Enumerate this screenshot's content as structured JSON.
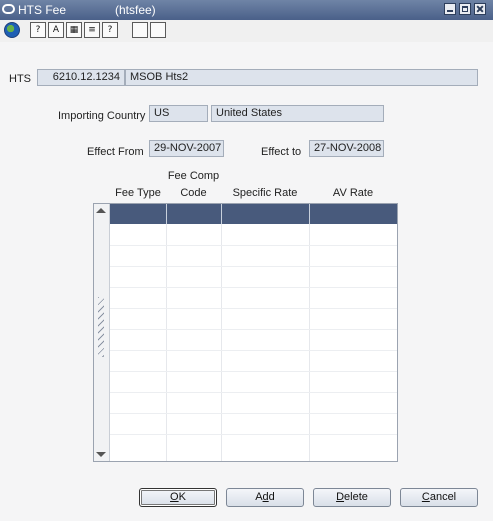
{
  "window": {
    "title": "HTS Fee",
    "subtitle": "(htsfee)"
  },
  "toolbar": {
    "icons": [
      "globe-icon",
      "help-icon",
      "spell-icon",
      "calendar-icon",
      "editor-icon",
      "help-question-icon",
      "blank-icon",
      "document-icon"
    ],
    "labels": {
      "spell": "A",
      "help": "?",
      "calendar": "▦",
      "editor": "≡",
      "help2": "?"
    }
  },
  "hts": {
    "label": "HTS",
    "code": "6210.12.1234",
    "description": "MSOB Hts2"
  },
  "importing_country": {
    "label": "Importing Country",
    "code": "US",
    "name": "United States"
  },
  "effect_from": {
    "label": "Effect From",
    "value": "29-NOV-2007"
  },
  "effect_to": {
    "label": "Effect to",
    "value": "27-NOV-2008"
  },
  "table": {
    "columns": [
      {
        "line1": "",
        "line2": "Fee Type"
      },
      {
        "line1": "Fee Comp",
        "line2": "Code"
      },
      {
        "line1": "",
        "line2": "Specific Rate"
      },
      {
        "line1": "",
        "line2": "AV Rate"
      }
    ],
    "rows": []
  },
  "buttons": {
    "ok": {
      "pre": "",
      "acc": "O",
      "post": "K"
    },
    "add": {
      "pre": "A",
      "acc": "d",
      "post": "d"
    },
    "delete": {
      "pre": "",
      "acc": "D",
      "post": "elete"
    },
    "cancel": {
      "pre": "",
      "acc": "C",
      "post": "ancel"
    }
  }
}
